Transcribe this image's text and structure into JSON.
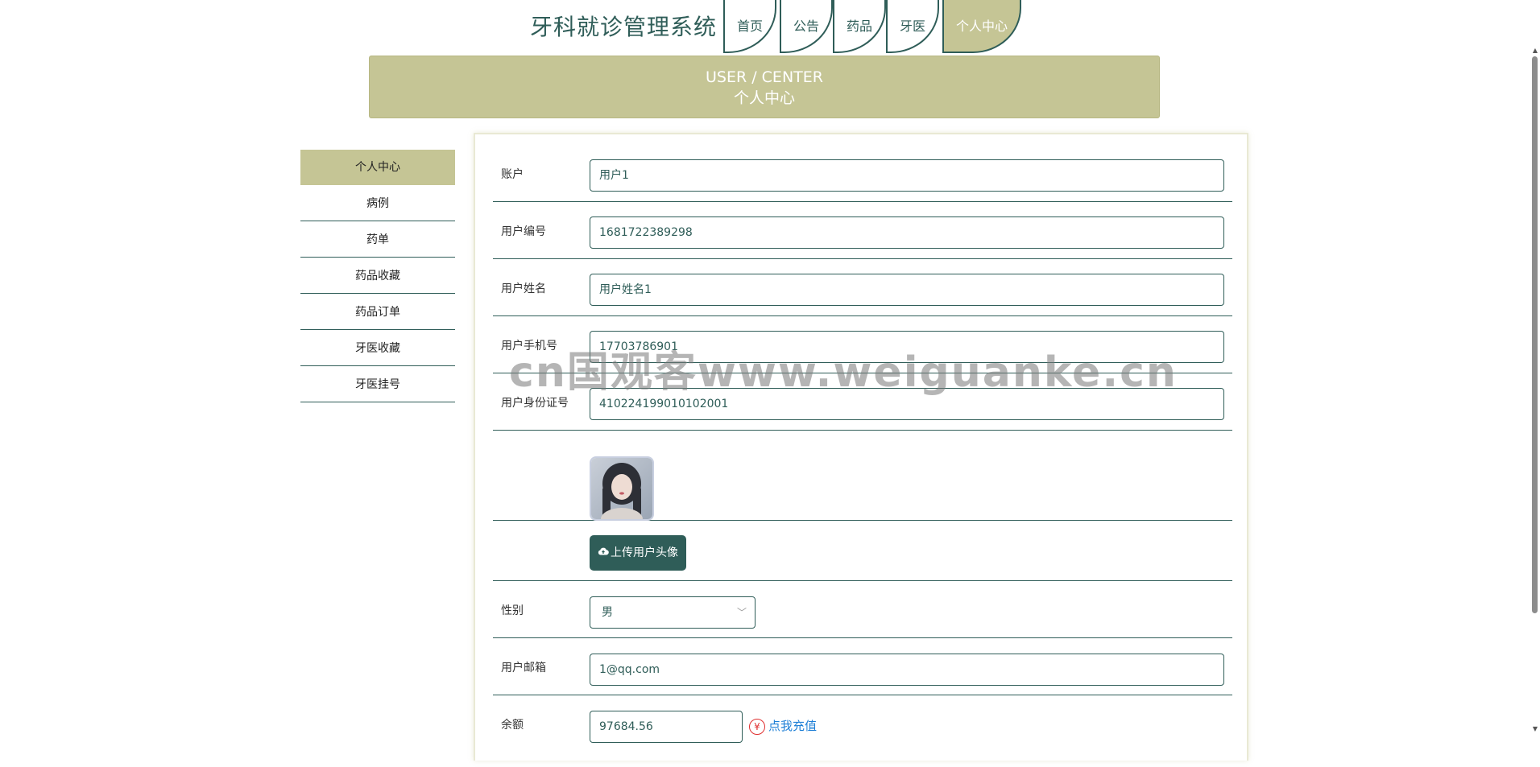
{
  "header": {
    "site_title": "牙科就诊管理系统",
    "nav": [
      "首页",
      "公告",
      "药品",
      "牙医",
      "个人中心"
    ],
    "active_nav": "个人中心"
  },
  "banner": {
    "en": "USER / CENTER",
    "cn": "个人中心"
  },
  "sidebar": {
    "items": [
      "个人中心",
      "病例",
      "药单",
      "药品收藏",
      "药品订单",
      "牙医收藏",
      "牙医挂号"
    ],
    "active": "个人中心"
  },
  "form": {
    "account": {
      "label": "账户",
      "value": "用户1"
    },
    "user_no": {
      "label": "用户编号",
      "value": "1681722389298"
    },
    "user_name": {
      "label": "用户姓名",
      "value": "用户姓名1"
    },
    "phone": {
      "label": "用户手机号",
      "value": "17703786901"
    },
    "id_card": {
      "label": "用户身份证号",
      "value": "410224199010102001"
    },
    "upload_label": "上传用户头像",
    "gender": {
      "label": "性别",
      "value": "男"
    },
    "email": {
      "label": "用户邮箱",
      "value": "1@qq.com"
    },
    "balance": {
      "label": "余额",
      "value": "97684.56",
      "recharge": "点我充值"
    }
  },
  "watermark": "cn国观客www.weiguanke.cn",
  "colors": {
    "primary": "#2f5d58",
    "accent": "#c5c595",
    "link": "#1e7fd6"
  },
  "icons": {
    "upload": "cloud-upload-icon",
    "recharge": "yen-circle-icon",
    "select": "chevron-down-icon"
  }
}
